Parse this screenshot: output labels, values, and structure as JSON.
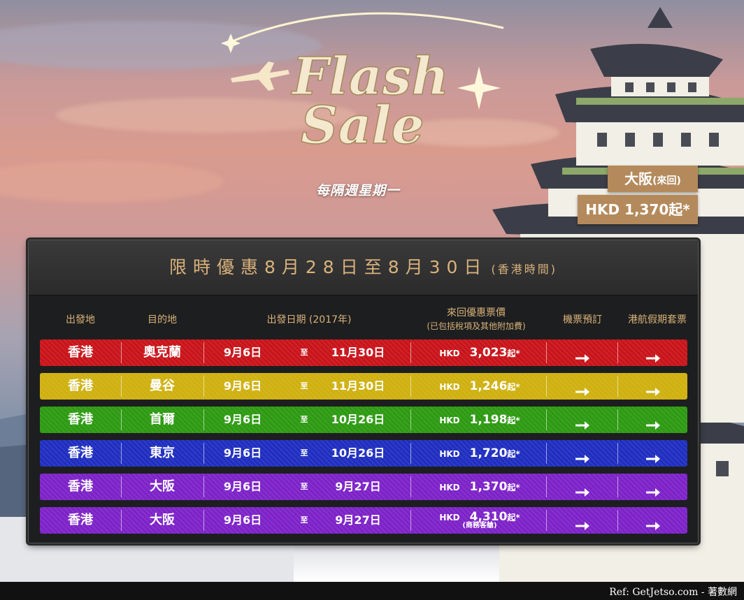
{
  "brand": {
    "logo_line1": "Flash",
    "logo_line2": "Sale",
    "subtitle": "每隔週星期一"
  },
  "promo": {
    "destination": "大阪",
    "trip": "(來回)",
    "price": "HKD 1,370起*"
  },
  "panel": {
    "title": "限時優惠8月28日至8月30日",
    "timezone": "(香港時間)"
  },
  "columns": {
    "origin": "出發地",
    "destination": "目的地",
    "dates": "出發日期 (2017年)",
    "fare": "來回優惠票價",
    "fare_note": "(已包括稅項及其他附加費)",
    "booking": "機票預訂",
    "package": "港航假期套票"
  },
  "rows": [
    {
      "origin": "香港",
      "destination": "奧克蘭",
      "start": "9月6日",
      "to": "至",
      "end": "11月30日",
      "currency": "HKD",
      "amount": "3,023",
      "suffix": "起*",
      "note": "",
      "color": "#c8141a"
    },
    {
      "origin": "香港",
      "destination": "曼谷",
      "start": "9月6日",
      "to": "至",
      "end": "11月30日",
      "currency": "HKD",
      "amount": "1,246",
      "suffix": "起*",
      "note": "",
      "color": "#cfb00f"
    },
    {
      "origin": "香港",
      "destination": "首爾",
      "start": "9月6日",
      "to": "至",
      "end": "10月26日",
      "currency": "HKD",
      "amount": "1,198",
      "suffix": "起*",
      "note": "",
      "color": "#2d9a12"
    },
    {
      "origin": "香港",
      "destination": "東京",
      "start": "9月6日",
      "to": "至",
      "end": "10月26日",
      "currency": "HKD",
      "amount": "1,720",
      "suffix": "起*",
      "note": "",
      "color": "#1f2ec0"
    },
    {
      "origin": "香港",
      "destination": "大阪",
      "start": "9月6日",
      "to": "至",
      "end": "9月27日",
      "currency": "HKD",
      "amount": "1,370",
      "suffix": "起*",
      "note": "",
      "color": "#7d22c8"
    },
    {
      "origin": "香港",
      "destination": "大阪",
      "start": "9月6日",
      "to": "至",
      "end": "9月27日",
      "currency": "HKD",
      "amount": "4,310",
      "suffix": "起*",
      "note": "(商務客艙)",
      "color": "#7d22c8"
    }
  ],
  "icons": {
    "row_action": "arrow-right-icon",
    "logo_mark": "airplane-icon",
    "sparkle": "sparkle-icon"
  },
  "colors": {
    "gold": "#d9b27a",
    "promo_bg": "#b48a5c",
    "panel_bg": "#1d1e1f"
  },
  "footer": {
    "ref": "Ref: GetJetso.com - 著數網"
  }
}
